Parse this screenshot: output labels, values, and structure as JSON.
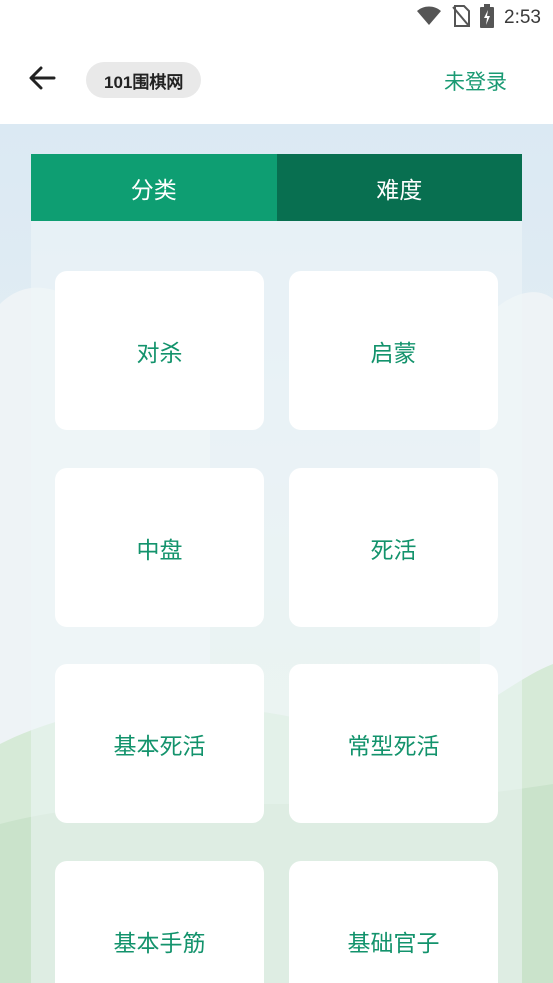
{
  "status_bar": {
    "time": "2:53",
    "icons": [
      "wifi-icon",
      "no-sim-icon",
      "battery-charging-icon"
    ]
  },
  "app_bar": {
    "back_icon": "arrow-left-icon",
    "site_name": "101围棋网",
    "login_label": "未登录"
  },
  "tabs": [
    {
      "label": "分类",
      "active": true
    },
    {
      "label": "难度",
      "active": false
    }
  ],
  "categories": [
    {
      "label": "对杀"
    },
    {
      "label": "启蒙"
    },
    {
      "label": "中盘"
    },
    {
      "label": "死活"
    },
    {
      "label": "基本死活"
    },
    {
      "label": "常型死活"
    },
    {
      "label": "基本手筋"
    },
    {
      "label": "基础官子"
    }
  ],
  "colors": {
    "accent": "#1a9a73",
    "tab_active": "#0e9e72",
    "tab_inactive": "#086f50",
    "card_text": "#13936c"
  }
}
